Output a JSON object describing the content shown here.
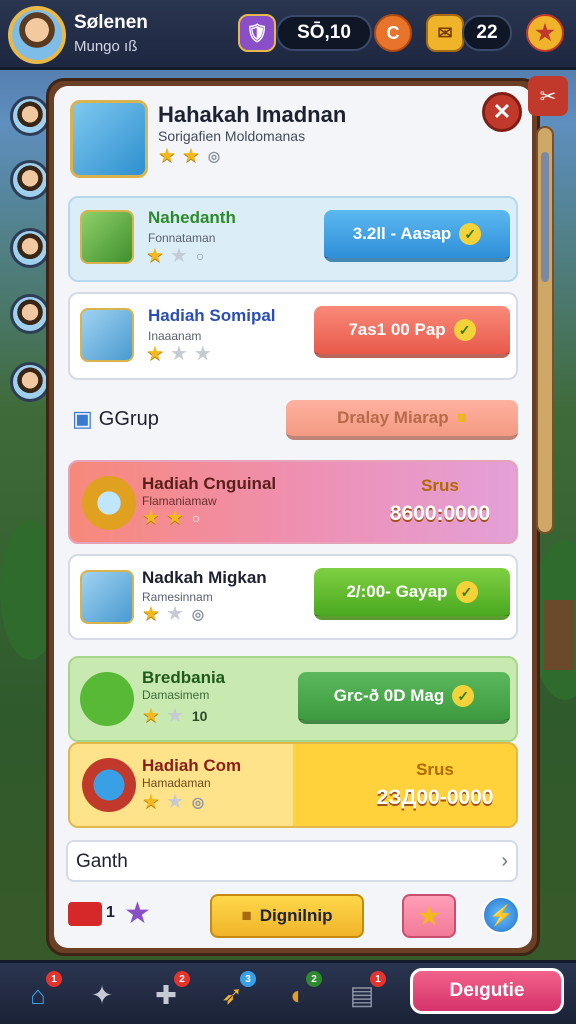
{
  "top_bar": {
    "player_name": "Sølenen",
    "player_sub": "Mungo ıß",
    "currency_1": "SŌ,10",
    "currency_2": "22",
    "coin_letter": "C"
  },
  "header": {
    "title": "Hahakah Imadnan",
    "subtitle": "Sorigafien Moldomanas",
    "stars_on": 2
  },
  "items": [
    {
      "title": "Nahedanth",
      "sub": "Fonnataman",
      "button": "3.2ll - Aasap",
      "stars_on": 1
    },
    {
      "title": "Hadiah Somipal",
      "sub": "Inaaanam",
      "button": "7as1 00 Pap",
      "stars_on": 1
    },
    {
      "title": "Hadiah Cnguinal",
      "sub": "Flamaniamaw",
      "reward_label": "Srus",
      "reward_value": "8600:0000",
      "stars_on": 2
    },
    {
      "title": "Nadkah Migkan",
      "sub": "Ramesinnam",
      "button": "2/:00- Gayap",
      "stars_on": 1
    },
    {
      "title": "Bredbania",
      "sub": "Damasimem",
      "button": "Grc-ð 0D Mag",
      "extra": "10",
      "stars_on": 1
    },
    {
      "title": "Hadiah Com",
      "sub": "Hamadaman",
      "reward_label": "Srus",
      "reward_value": "2ЗД00-0000",
      "stars_on": 1
    }
  ],
  "group": {
    "label": "GGrup",
    "button": "Dralay Miarap"
  },
  "search": {
    "value": "Ganth"
  },
  "footer": {
    "count": "1",
    "main_button": "Dignilnip"
  },
  "bottom_nav": {
    "cta": "Deıgutie",
    "badges": [
      "1",
      "",
      "2",
      "3",
      "2",
      "1"
    ]
  },
  "colors": {
    "panel_wood": "#6b3f25",
    "panel_bg": "#f4f5f8",
    "blue_button": "#3aa0e6",
    "red_button": "#f06a5a",
    "green_button": "#57b936",
    "pink_cta": "#e0417a"
  }
}
